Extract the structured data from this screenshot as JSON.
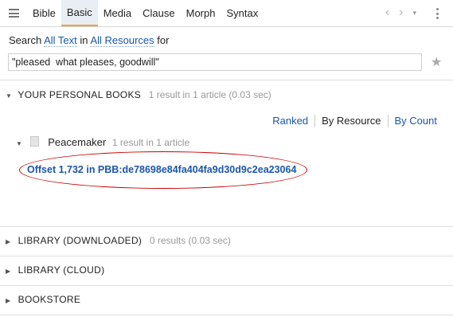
{
  "tabs": [
    "Bible",
    "Basic",
    "Media",
    "Clause",
    "Morph",
    "Syntax"
  ],
  "active_tab": "Basic",
  "nav": {
    "back": "‹",
    "forward": "›",
    "dropdown": "▾"
  },
  "search": {
    "prefix": "Search",
    "scope_text": "All Text",
    "in_word": "in",
    "scope_resources": "All Resources",
    "for_word": "for",
    "query": "\"pleased  what pleases, goodwill\""
  },
  "sections": {
    "personal": {
      "title": "YOUR PERSONAL BOOKS",
      "meta": "1 result in 1 article (0.03 sec)",
      "expanded": true
    },
    "downloaded": {
      "title": "LIBRARY (DOWNLOADED)",
      "meta": "0 results (0.03 sec)"
    },
    "cloud": {
      "title": "LIBRARY (CLOUD)"
    },
    "bookstore": {
      "title": "BOOKSTORE"
    }
  },
  "sort": {
    "ranked": "Ranked",
    "by_resource": "By Resource",
    "by_count": "By Count",
    "selected": "By Resource"
  },
  "book": {
    "name": "Peacemaker",
    "meta": "1 result in 1 article"
  },
  "result": {
    "text": "Offset 1,732 in PBB:de78698e84fa404fa9d30d9c2ea23064"
  },
  "colors": {
    "link": "#1a56a8",
    "active_tab_underline": "#f0a030",
    "annotation_oval": "#cc0000"
  }
}
